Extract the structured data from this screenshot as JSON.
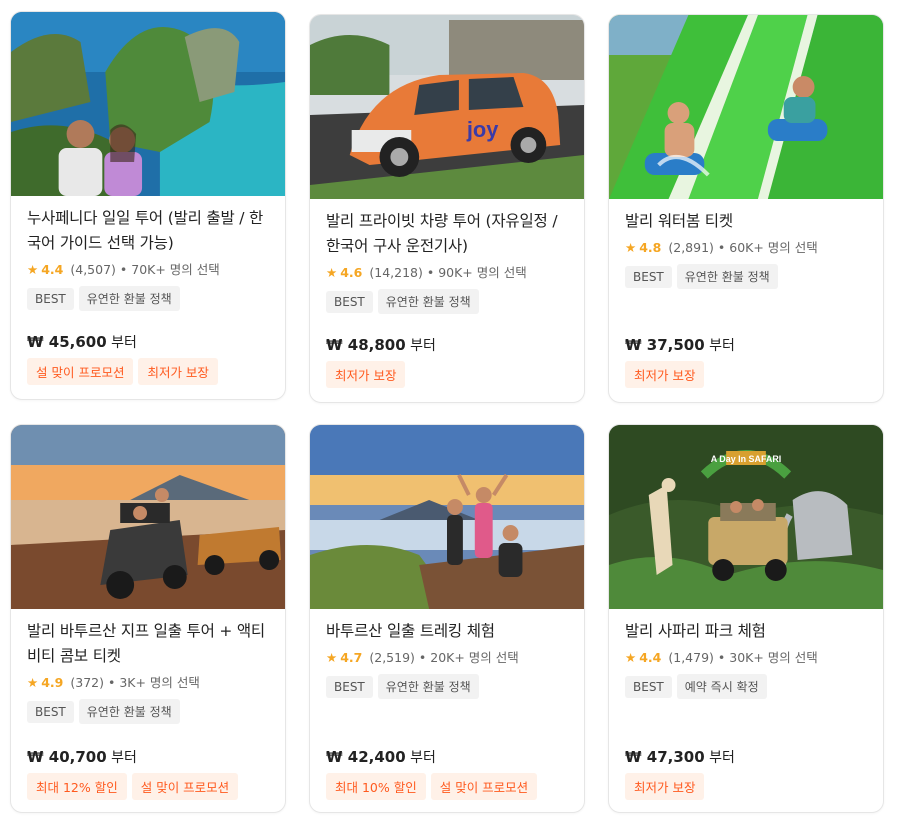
{
  "cards": [
    {
      "title": "누사페니다 일일 투어 (발리 출발 / 한국어 가이드 선택 가능)",
      "rating": "4.4",
      "reviews": "(4,507)",
      "booked": "• 70K+ 명의 선택",
      "tags": [
        "BEST",
        "유연한 환불 정책"
      ],
      "price_prefix": "₩ ",
      "price": "45,600",
      "price_suffix": " 부터",
      "promos": [
        "설 맞이 프로모션",
        "최저가 보장"
      ]
    },
    {
      "title": "발리 프라이빗 차량 투어 (자유일정 / 한국어 구사 운전기사)",
      "rating": "4.6",
      "reviews": "(14,218)",
      "booked": "• 90K+ 명의 선택",
      "tags": [
        "BEST",
        "유연한 환불 정책"
      ],
      "price_prefix": "₩ ",
      "price": "48,800",
      "price_suffix": " 부터",
      "promos": [
        "최저가 보장"
      ],
      "image_text": "joy"
    },
    {
      "title": "발리 워터봄 티켓",
      "rating": "4.8",
      "reviews": "(2,891)",
      "booked": "• 60K+ 명의 선택",
      "tags": [
        "BEST",
        "유연한 환불 정책"
      ],
      "price_prefix": "₩ ",
      "price": "37,500",
      "price_suffix": " 부터",
      "promos": [
        "최저가 보장"
      ]
    },
    {
      "title": "발리 바투르산 지프 일출 투어 + 액티비티 콤보 티켓",
      "rating": "4.9",
      "reviews": "(372)",
      "booked": "• 3K+ 명의 선택",
      "tags": [
        "BEST",
        "유연한 환불 정책"
      ],
      "price_prefix": "₩ ",
      "price": "40,700",
      "price_suffix": " 부터",
      "promos": [
        "최대 12% 할인",
        "설 맞이 프로모션"
      ]
    },
    {
      "title": "바투르산 일출 트레킹 체험",
      "rating": "4.7",
      "reviews": "(2,519)",
      "booked": "• 20K+ 명의 선택",
      "tags": [
        "BEST",
        "유연한 환불 정책"
      ],
      "price_prefix": "₩ ",
      "price": "42,400",
      "price_suffix": " 부터",
      "promos": [
        "최대 10% 할인",
        "설 맞이 프로모션"
      ]
    },
    {
      "title": "발리 사파리 파크 체험",
      "rating": "4.4",
      "reviews": "(1,479)",
      "booked": "• 30K+ 명의 선택",
      "tags": [
        "BEST",
        "예약 즉시 확정"
      ],
      "price_prefix": "₩ ",
      "price": "47,300",
      "price_suffix": " 부터",
      "promos": [
        "최저가 보장"
      ],
      "image_text": "A Day In SAFARI"
    }
  ],
  "icons": {
    "rating": "star-icon"
  },
  "colors": {
    "star": "#f5a623",
    "promo_text": "#ff5a1f",
    "promo_bg": "#fff1e8",
    "tag_bg": "#f2f2f2"
  }
}
